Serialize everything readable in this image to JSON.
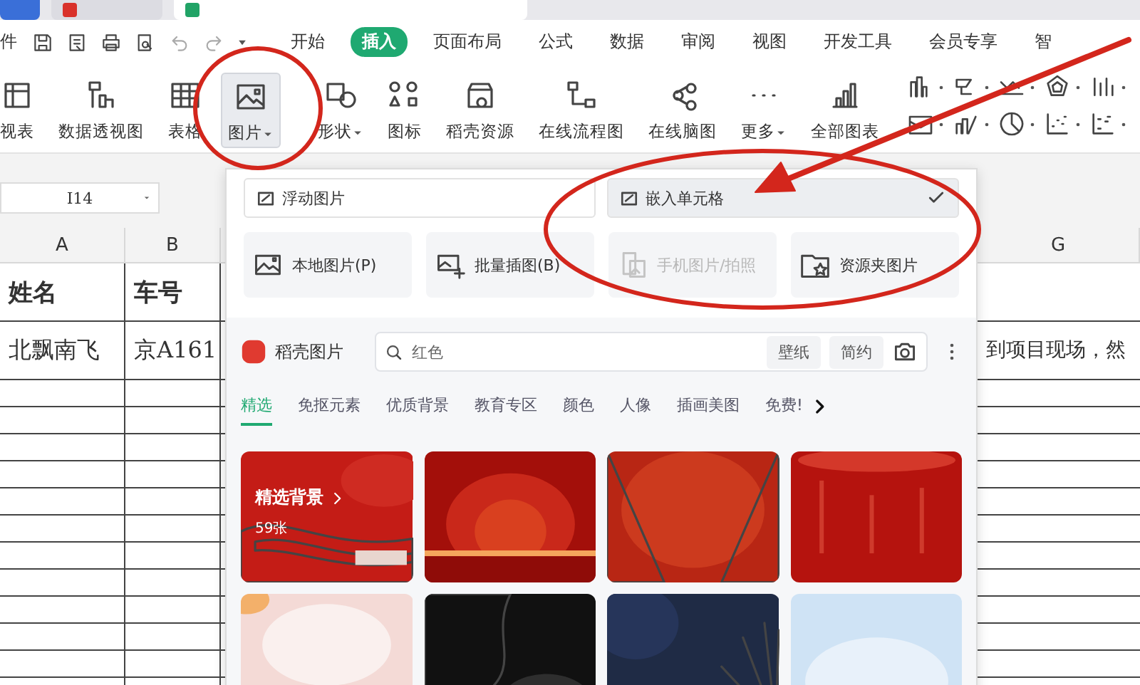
{
  "file_menu": "件",
  "menu_tabs": [
    {
      "label": "开始",
      "selected": false
    },
    {
      "label": "插入",
      "selected": true
    },
    {
      "label": "页面布局",
      "selected": false
    },
    {
      "label": "公式",
      "selected": false
    },
    {
      "label": "数据",
      "selected": false
    },
    {
      "label": "审阅",
      "selected": false
    },
    {
      "label": "视图",
      "selected": false
    },
    {
      "label": "开发工具",
      "selected": false
    },
    {
      "label": "会员专享",
      "selected": false
    },
    {
      "label": "智",
      "selected": false
    }
  ],
  "ribbon": [
    {
      "label": "视表",
      "dropdown": false,
      "selected": false
    },
    {
      "label": "数据透视图",
      "dropdown": false,
      "selected": false
    },
    {
      "label": "表格",
      "dropdown": false,
      "selected": false
    },
    {
      "label": "图片",
      "dropdown": true,
      "selected": true
    },
    {
      "label": "形状",
      "dropdown": true,
      "selected": false
    },
    {
      "label": "图标",
      "dropdown": false,
      "selected": false
    },
    {
      "label": "稻壳资源",
      "dropdown": false,
      "selected": false
    },
    {
      "label": "在线流程图",
      "dropdown": false,
      "selected": false
    },
    {
      "label": "在线脑图",
      "dropdown": false,
      "selected": false
    },
    {
      "label": "更多",
      "dropdown": true,
      "selected": false
    },
    {
      "label": "全部图表",
      "dropdown": false,
      "selected": false
    }
  ],
  "name_box": {
    "value": "I14"
  },
  "columns": [
    "A",
    "B",
    "G"
  ],
  "rows": [
    {
      "header": true,
      "a": "姓名",
      "b": "车号"
    },
    {
      "header": false,
      "a": "北飘南飞",
      "b": "京A161",
      "g": "到项目现场，然"
    }
  ],
  "picture_panel": {
    "modes": [
      {
        "label": "浮动图片",
        "selected": false
      },
      {
        "label": "嵌入单元格",
        "selected": true
      }
    ],
    "sources": [
      {
        "label": "本地图片(P)",
        "disabled": false
      },
      {
        "label": "批量插图(B)",
        "disabled": false
      },
      {
        "label": "手机图片/拍照",
        "disabled": true
      },
      {
        "label": "资源夹图片",
        "disabled": false
      }
    ],
    "brand": "稻壳图片",
    "search": {
      "value": "红色"
    },
    "chips": [
      "壁纸",
      "简约"
    ],
    "categories": [
      {
        "label": "精选",
        "selected": true
      },
      {
        "label": "免抠元素",
        "selected": false
      },
      {
        "label": "优质背景",
        "selected": false
      },
      {
        "label": "教育专区",
        "selected": false
      },
      {
        "label": "颜色",
        "selected": false
      },
      {
        "label": "人像",
        "selected": false
      },
      {
        "label": "插画美图",
        "selected": false
      },
      {
        "label": "免费!",
        "selected": false
      }
    ],
    "images": [
      {
        "kind": "picture",
        "title": "精选背景",
        "count": "59张"
      },
      {
        "kind": "picture"
      },
      {
        "kind": "picture"
      },
      {
        "kind": "picture"
      },
      {
        "kind": "picture"
      },
      {
        "kind": "picture"
      },
      {
        "kind": "picture"
      },
      {
        "kind": "picture"
      }
    ]
  }
}
